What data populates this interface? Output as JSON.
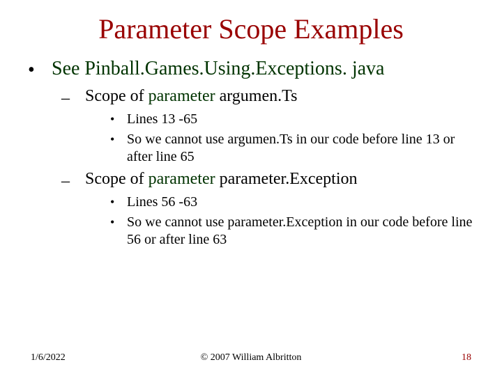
{
  "title": "Parameter Scope Examples",
  "l1": {
    "bullet": "•",
    "text": "See Pinball.Games.Using.Exceptions. java"
  },
  "l2a": {
    "bullet": "–",
    "scope_of": "Scope of ",
    "param": "parameter",
    "name": " argumen.Ts"
  },
  "l3a1": {
    "bullet": "•",
    "text": "Lines 13 -65"
  },
  "l3a2": {
    "bullet": "•",
    "text": "So we cannot use argumen.Ts in our code before line 13 or after line 65"
  },
  "l2b": {
    "bullet": "–",
    "scope_of": "Scope of ",
    "param": "parameter",
    "name": " parameter.Exception"
  },
  "l3b1": {
    "bullet": "•",
    "text": "Lines 56 -63"
  },
  "l3b2": {
    "bullet": "•",
    "text": "So we cannot use parameter.Exception in our code before line 56 or after line 63"
  },
  "footer": {
    "date": "1/6/2022",
    "copyright": "© 2007 William Albritton",
    "page": "18"
  }
}
